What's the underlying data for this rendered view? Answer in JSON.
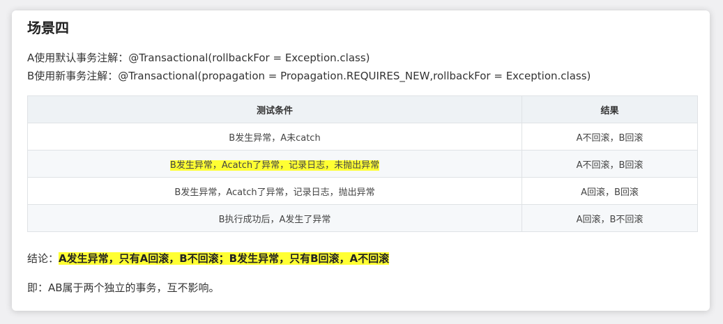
{
  "title": "场景四",
  "intro": {
    "line_a": "A使用默认事务注解：@Transactional(rollbackFor = Exception.class)",
    "line_b": "B使用新事务注解：@Transactional(propagation = Propagation.REQUIRES_NEW,rollbackFor = Exception.class)"
  },
  "table": {
    "headers": [
      "测试条件",
      "结果"
    ],
    "rows": [
      {
        "condition": "B发生异常，A未catch",
        "result": "A不回滚，B回滚"
      },
      {
        "condition": "B发生异常，Acatch了异常，记录日志，未抛出异常",
        "result": "A不回滚，B回滚"
      },
      {
        "condition": "B发生异常，Acatch了异常，记录日志，抛出异常",
        "result": "A回滚，B回滚"
      },
      {
        "condition": "B执行成功后，A发生了异常",
        "result": "A回滚，B不回滚"
      }
    ]
  },
  "conclusion": {
    "label": "结论：",
    "text": "A发生异常，只有A回滚，B不回滚；B发生异常，只有B回滚，A不回滚"
  },
  "note": "即：AB属于两个独立的事务，互不影响。",
  "colors": {
    "highlight": "#ffff33",
    "header_bg": "#eef2f5",
    "stripe_bg": "#f6f8fa",
    "border": "#dfe2e5"
  }
}
